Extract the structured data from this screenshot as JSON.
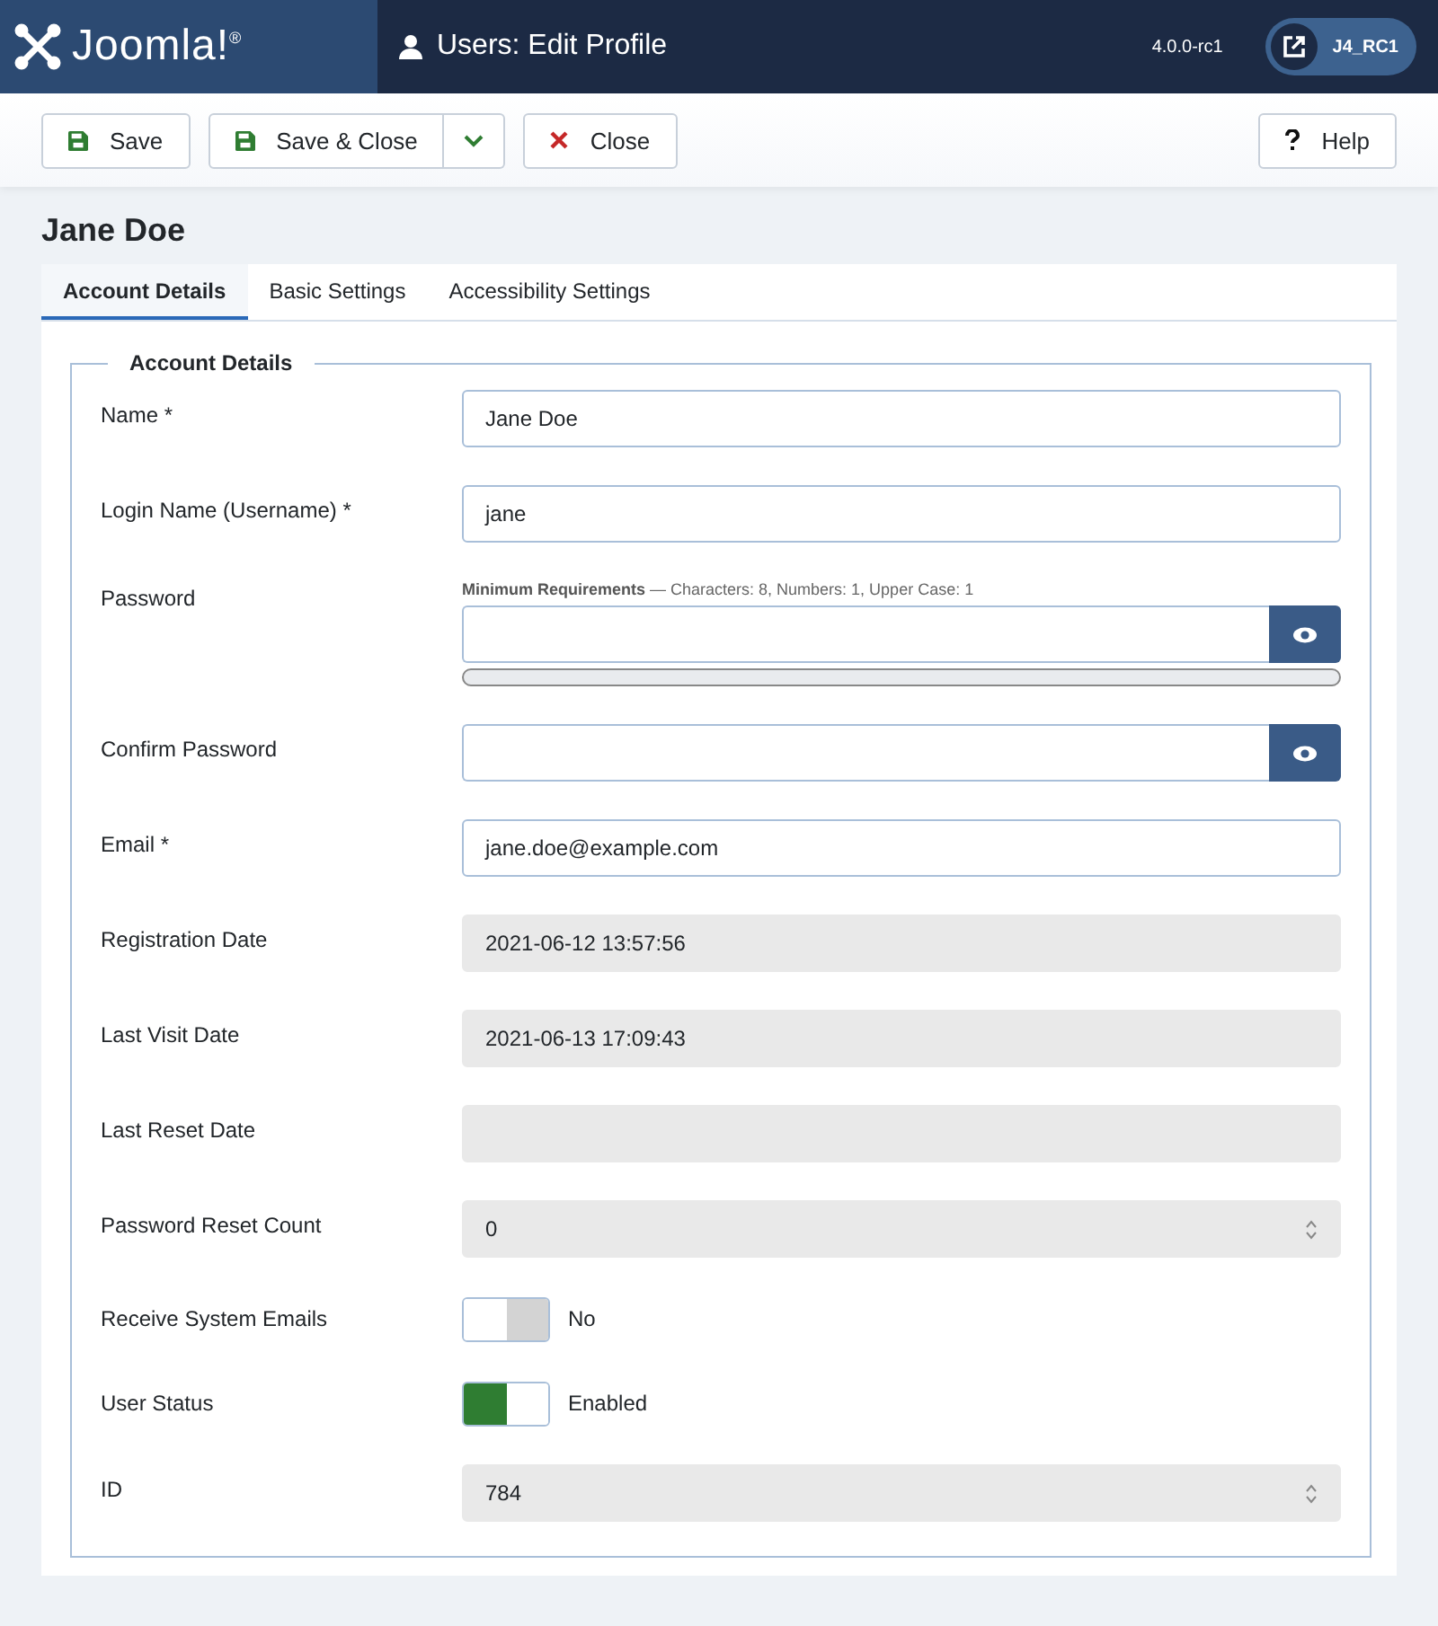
{
  "header": {
    "logo": "Joomla!$^{®}$",
    "title": "Users: Edit Profile",
    "version": "4.0.0-rc1",
    "site_button": "J4_RC1"
  },
  "toolbar": {
    "buttons": [
      {
        "kind": "save",
        "label": "Save"
      },
      {
        "kind": "save-close",
        "label": "Save & Close"
      },
      {
        "kind": "close",
        "label": "Close"
      }
    ],
    "help": "Help"
  },
  "page_title": "Jane Doe",
  "tabs": [
    {
      "label": "Account Details",
      "selected": true
    },
    {
      "label": "Basic Settings",
      "selected": false
    },
    {
      "label": "Accessibility Settings",
      "selected": false
    }
  ],
  "fieldset": {
    "legend": "Account Details",
    "fields": [
      {
        "kind": "text",
        "label": "Name *",
        "value": "Jane Doe"
      },
      {
        "kind": "text",
        "label": "Login Name (Username) *",
        "value": "jane"
      },
      {
        "kind": "password",
        "label": "Password",
        "hint": "**Minimum Requirements** — Characters: 8, Numbers: 1, Upper Case: 1",
        "level": 0
      },
      {
        "kind": "password",
        "label": "Confirm Password"
      },
      {
        "kind": "text",
        "label": "Email *",
        "value": "jane.doe@example.com"
      },
      {
        "kind": "readonly",
        "label": "Registration Date",
        "value": "2021-06-12 13:57:56"
      },
      {
        "kind": "readonly",
        "label": "Last Visit Date",
        "value": "2021-06-13 17:09:43"
      },
      {
        "kind": "readonly",
        "label": "Last Reset Date"
      },
      {
        "kind": "number",
        "label": "Password Reset Count",
        "value": "0"
      },
      {
        "kind": "toggle",
        "label": "Receive System Emails",
        "on": false,
        "state_text": "No"
      },
      {
        "kind": "toggle",
        "label": "User Status",
        "on": true,
        "state_text": "Enabled"
      },
      {
        "kind": "number",
        "label": "ID",
        "value": "784"
      }
    ]
  }
}
